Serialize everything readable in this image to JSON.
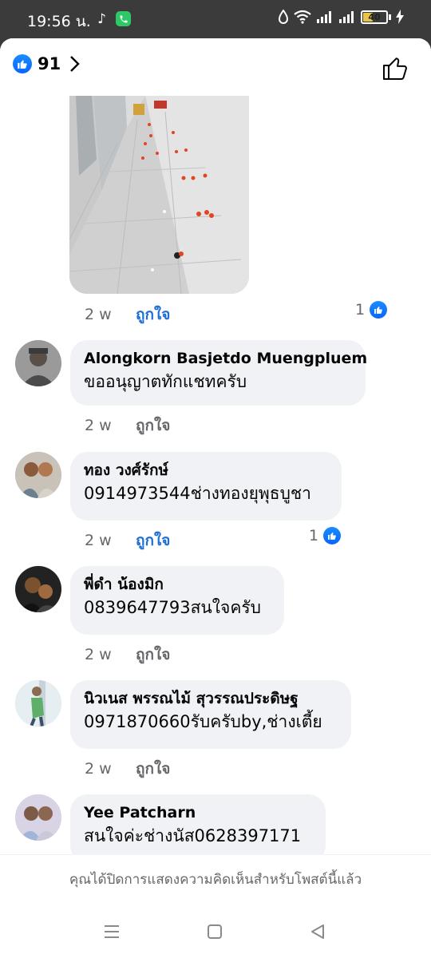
{
  "status_bar": {
    "time": "19:56 น.",
    "battery": "40",
    "battery_level": 0.4
  },
  "header": {
    "reaction_count": "91",
    "icons": [
      "like-icon",
      "chevron-right-icon",
      "thumbs-up-outline-icon"
    ]
  },
  "post_comment": {
    "time": "2 w",
    "like_label": "ถูกใจ",
    "reaction_count": "1"
  },
  "comments": [
    {
      "author": "Alongkorn Basjetdo Muengpluem",
      "text": "ขออนุญาตทักแชทครับ",
      "time": "2 w",
      "like_label": "ถูกใจ",
      "reaction_count": ""
    },
    {
      "author": "ทอง วงศ์รักษ์",
      "text": "0914973544ช่างทองยุพุธบูชา",
      "time": "2 w",
      "like_label": "ถูกใจ",
      "reaction_count": "1"
    },
    {
      "author": "พี่ดำ น้องมิก",
      "text": "0839647793สนใจครับ",
      "time": "2 w",
      "like_label": "ถูกใจ",
      "reaction_count": ""
    },
    {
      "author": "นิวเนส พรรณไม้ สุวรรณประดิษฐ",
      "text": "0971870660รับครับby,ช่างเตี้ย",
      "time": "2 w",
      "like_label": "ถูกใจ",
      "reaction_count": ""
    },
    {
      "author": "Yee Patcharn",
      "text": "สนใจค่ะช่างนัส0628397171",
      "time": "",
      "like_label": "",
      "reaction_count": ""
    }
  ],
  "notice": "คุณได้ปิดการแสดงความคิดเห็นสำหรับโพสต์นี้แล้ว",
  "nav": [
    "menu-icon",
    "home-square-icon",
    "back-triangle-icon"
  ],
  "colors": {
    "accent": "#1d6fd6",
    "like_blue": "#0866ff",
    "bubble": "#f0f2f5",
    "muted": "#65676b"
  }
}
